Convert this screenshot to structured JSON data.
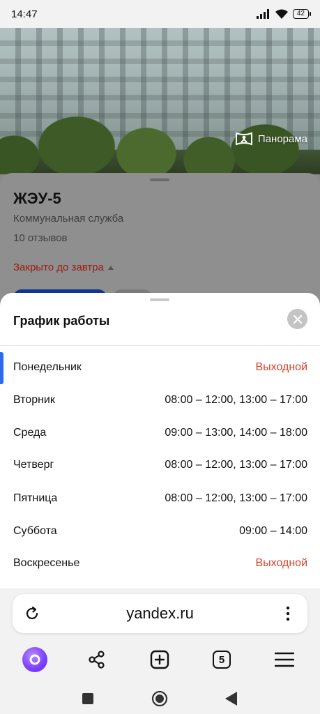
{
  "status_bar": {
    "time": "14:47",
    "battery": "42"
  },
  "photo": {
    "panorama_label": "Панорама"
  },
  "org": {
    "name": "ЖЭУ-5",
    "type": "Коммунальная служба",
    "reviews": "10 отзывов",
    "status": "Закрыто до завтра"
  },
  "schedule": {
    "title": "График работы",
    "days": [
      {
        "day": "Понедельник",
        "hours": "Выходной",
        "off": true,
        "active": true
      },
      {
        "day": "Вторник",
        "hours": "08:00 – 12:00, 13:00 – 17:00",
        "off": false
      },
      {
        "day": "Среда",
        "hours": "09:00 – 13:00, 14:00 – 18:00",
        "off": false
      },
      {
        "day": "Четверг",
        "hours": "08:00 – 12:00, 13:00 – 17:00",
        "off": false
      },
      {
        "day": "Пятница",
        "hours": "08:00 – 12:00, 13:00 – 17:00",
        "off": false
      },
      {
        "day": "Суббота",
        "hours": "09:00 – 14:00",
        "off": false
      },
      {
        "day": "Воскресенье",
        "hours": "Выходной",
        "off": true
      }
    ]
  },
  "browser": {
    "url": "yandex.ru",
    "tabs_count": "5"
  },
  "colors": {
    "accent_blue": "#2a6cf0",
    "closed_red": "#d8412a",
    "alice_purple": "#7a3dff"
  },
  "icons": [
    "signal-icon",
    "wifi-icon",
    "battery-icon",
    "panorama-icon",
    "close-icon",
    "reload-icon",
    "more-vertical-icon",
    "alice-icon",
    "share-icon",
    "new-tab-icon",
    "tabs-icon",
    "menu-icon",
    "recents-icon",
    "home-icon",
    "back-icon"
  ]
}
